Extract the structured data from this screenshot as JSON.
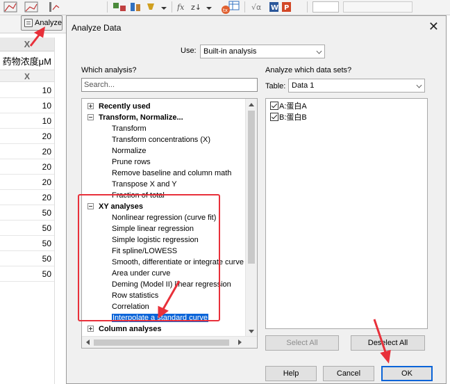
{
  "app": {
    "analyze_button": "Analyze",
    "column": {
      "letter": "X",
      "title": "药物浓度μM",
      "subheader": "X",
      "values": [
        "10",
        "10",
        "10",
        "20",
        "20",
        "20",
        "20",
        "20",
        "50",
        "50",
        "50",
        "50",
        "50"
      ]
    }
  },
  "dialog": {
    "title": "Analyze Data",
    "use_label": "Use:",
    "use_value": "Built-in analysis",
    "which_analysis_label": "Which analysis?",
    "search_placeholder": "Search...",
    "which_datasets_label": "Analyze which data sets?",
    "table_label": "Table:",
    "table_value": "Data 1",
    "tree": [
      {
        "label": "Recently used",
        "type": "group",
        "expanded": false
      },
      {
        "label": "Transform, Normalize...",
        "type": "group",
        "expanded": true
      },
      {
        "label": "Transform",
        "type": "leaf"
      },
      {
        "label": "Transform concentrations (X)",
        "type": "leaf"
      },
      {
        "label": "Normalize",
        "type": "leaf"
      },
      {
        "label": "Prune rows",
        "type": "leaf"
      },
      {
        "label": "Remove baseline and column math",
        "type": "leaf"
      },
      {
        "label": "Transpose X and Y",
        "type": "leaf"
      },
      {
        "label": "Fraction of total",
        "type": "leaf"
      },
      {
        "label": "XY analyses",
        "type": "group",
        "expanded": true
      },
      {
        "label": "Nonlinear regression (curve fit)",
        "type": "leaf"
      },
      {
        "label": "Simple linear regression",
        "type": "leaf"
      },
      {
        "label": "Simple logistic regression",
        "type": "leaf"
      },
      {
        "label": "Fit spline/LOWESS",
        "type": "leaf"
      },
      {
        "label": "Smooth, differentiate or integrate curve",
        "type": "leaf"
      },
      {
        "label": "Area under curve",
        "type": "leaf"
      },
      {
        "label": "Deming (Model II) linear regression",
        "type": "leaf"
      },
      {
        "label": "Row statistics",
        "type": "leaf"
      },
      {
        "label": "Correlation",
        "type": "leaf"
      },
      {
        "label": "Interpolate a standard curve",
        "type": "leaf",
        "selected": true
      },
      {
        "label": "Column analyses",
        "type": "group",
        "expanded": false
      }
    ],
    "datasets": [
      {
        "label": "A:蛋白A",
        "checked": true
      },
      {
        "label": "B:蛋白B",
        "checked": true
      }
    ],
    "select_all": "Select All",
    "deselect_all": "Deselect All",
    "help": "Help",
    "cancel": "Cancel",
    "ok": "OK"
  },
  "colors": {
    "annotation_red": "#e8303a",
    "selection_blue": "#0a64d8"
  }
}
